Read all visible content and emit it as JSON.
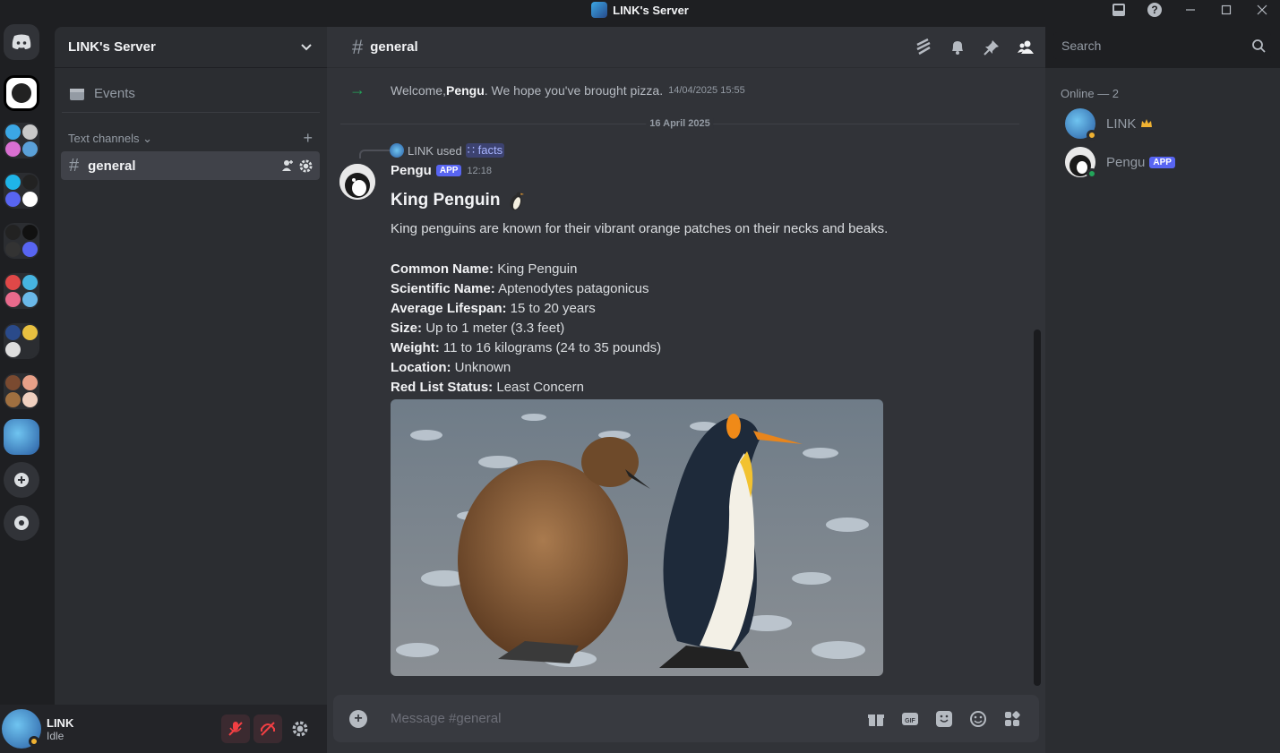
{
  "window": {
    "title": "LINK's Server"
  },
  "server": {
    "name": "LINK's Server",
    "events_label": "Events",
    "category": "Text channels"
  },
  "channel": {
    "name": "general",
    "hash": "#"
  },
  "user": {
    "name": "LINK",
    "status": "Idle"
  },
  "system_message": {
    "prefix": "Welcome, ",
    "user": "Pengu",
    "suffix": ". We hope you've brought pizza.",
    "timestamp": "14/04/2025 15:55"
  },
  "date_divider": "16 April 2025",
  "reply": {
    "user": "LINK",
    "used": "used",
    "command": "facts"
  },
  "message": {
    "author": "Pengu",
    "badge": "APP",
    "timestamp": "12:18",
    "embed_title": "King Penguin",
    "embed_description": "King penguins are known for their vibrant orange patches on their necks and beaks.",
    "fields": [
      {
        "label": "Common Name:",
        "value": "King Penguin"
      },
      {
        "label": "Scientific Name:",
        "value": "Aptenodytes patagonicus"
      },
      {
        "label": "Average Lifespan:",
        "value": "15 to 20 years"
      },
      {
        "label": "Size:",
        "value": "Up to 1 meter (3.3 feet)"
      },
      {
        "label": "Weight:",
        "value": "11 to 16 kilograms (24 to 35 pounds)"
      },
      {
        "label": "Location:",
        "value": "Unknown"
      },
      {
        "label": "Red List Status:",
        "value": "Least Concern"
      }
    ]
  },
  "composer": {
    "placeholder": "Message #general"
  },
  "search": {
    "placeholder": "Search"
  },
  "members": {
    "header": "Online — 2",
    "list": [
      {
        "name": "LINK",
        "badge": ""
      },
      {
        "name": "Pengu",
        "badge": "APP"
      }
    ]
  },
  "colors": {
    "accent": "#5865f2",
    "online": "#23a55a",
    "idle": "#f0b232",
    "crown": "#f0b232"
  }
}
